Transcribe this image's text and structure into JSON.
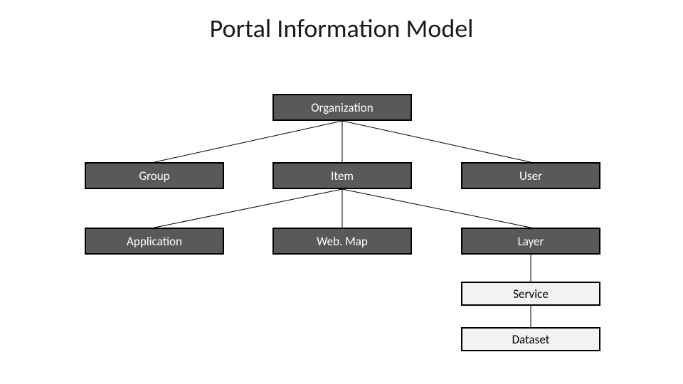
{
  "title": "Portal Information Model",
  "nodes": {
    "organization": "Organization",
    "group": "Group",
    "item": "Item",
    "user": "User",
    "application": "Application",
    "webmap": "Web. Map",
    "layer": "Layer",
    "service": "Service",
    "dataset": "Dataset"
  },
  "edges": [
    {
      "from": "organization",
      "to": "group"
    },
    {
      "from": "organization",
      "to": "item"
    },
    {
      "from": "organization",
      "to": "user"
    },
    {
      "from": "item",
      "to": "application"
    },
    {
      "from": "item",
      "to": "webmap"
    },
    {
      "from": "item",
      "to": "layer"
    },
    {
      "from": "layer",
      "to": "service"
    },
    {
      "from": "service",
      "to": "dataset"
    }
  ],
  "chart_data": {
    "type": "diagram",
    "title": "Portal Information Model",
    "nodes": [
      {
        "id": "organization",
        "label": "Organization",
        "style": "dark",
        "level": 0
      },
      {
        "id": "group",
        "label": "Group",
        "style": "dark",
        "level": 1
      },
      {
        "id": "item",
        "label": "Item",
        "style": "dark",
        "level": 1
      },
      {
        "id": "user",
        "label": "User",
        "style": "dark",
        "level": 1
      },
      {
        "id": "application",
        "label": "Application",
        "style": "dark",
        "level": 2
      },
      {
        "id": "webmap",
        "label": "Web. Map",
        "style": "dark",
        "level": 2
      },
      {
        "id": "layer",
        "label": "Layer",
        "style": "dark",
        "level": 2
      },
      {
        "id": "service",
        "label": "Service",
        "style": "light",
        "level": 3
      },
      {
        "id": "dataset",
        "label": "Dataset",
        "style": "light",
        "level": 4
      }
    ],
    "edges": [
      {
        "from": "organization",
        "to": "group"
      },
      {
        "from": "organization",
        "to": "item"
      },
      {
        "from": "organization",
        "to": "user"
      },
      {
        "from": "item",
        "to": "application"
      },
      {
        "from": "item",
        "to": "webmap"
      },
      {
        "from": "item",
        "to": "layer"
      },
      {
        "from": "layer",
        "to": "service"
      },
      {
        "from": "service",
        "to": "dataset"
      }
    ]
  }
}
